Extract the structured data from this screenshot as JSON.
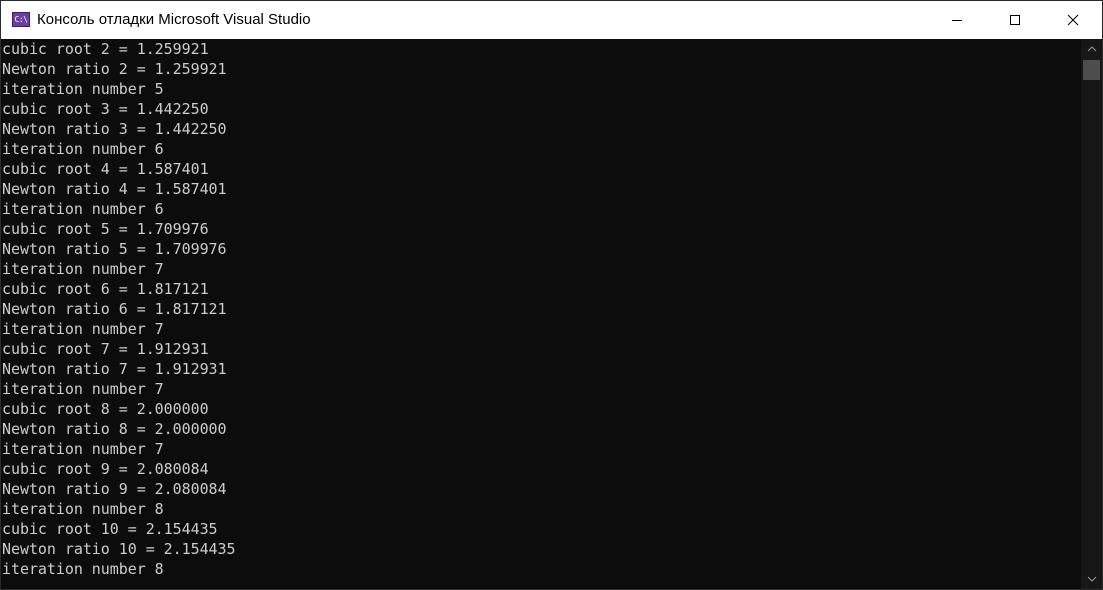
{
  "window": {
    "title": "Консоль отладки Microsoft Visual Studio",
    "icon": "console-app-icon",
    "icon_glyph": "C:\\"
  },
  "controls": {
    "minimize": "minimize-icon",
    "maximize": "maximize-icon",
    "close": "close-icon"
  },
  "console": {
    "lines": [
      "cubic root 2 = 1.259921",
      "Newton ratio 2 = 1.259921",
      "iteration number 5",
      "cubic root 3 = 1.442250",
      "Newton ratio 3 = 1.442250",
      "iteration number 6",
      "cubic root 4 = 1.587401",
      "Newton ratio 4 = 1.587401",
      "iteration number 6",
      "cubic root 5 = 1.709976",
      "Newton ratio 5 = 1.709976",
      "iteration number 7",
      "cubic root 6 = 1.817121",
      "Newton ratio 6 = 1.817121",
      "iteration number 7",
      "cubic root 7 = 1.912931",
      "Newton ratio 7 = 1.912931",
      "iteration number 7",
      "cubic root 8 = 2.000000",
      "Newton ratio 8 = 2.000000",
      "iteration number 7",
      "cubic root 9 = 2.080084",
      "Newton ratio 9 = 2.080084",
      "iteration number 8",
      "cubic root 10 = 2.154435",
      "Newton ratio 10 = 2.154435",
      "iteration number 8"
    ]
  },
  "colors": {
    "console_bg": "#0c0c0c",
    "console_text": "#cccccc",
    "titlebar_bg": "#ffffff",
    "scroll_track": "#171717",
    "scroll_thumb": "#4d4d4d"
  }
}
